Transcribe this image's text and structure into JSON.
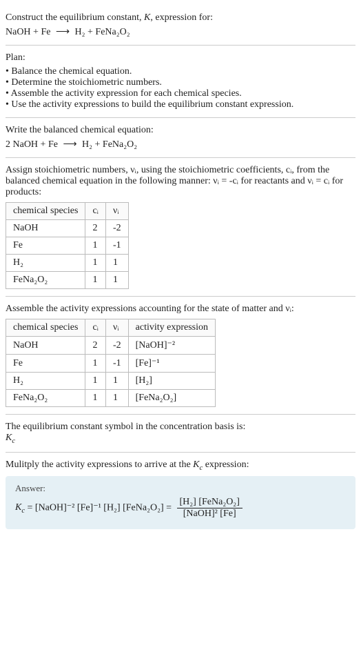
{
  "header": {
    "title_line1": "Construct the equilibrium constant, K, expression for:",
    "eq_lhs": "NaOH + Fe",
    "arrow": "⟶",
    "eq_rhs": "H₂ + FeNa₂O₂"
  },
  "plan": {
    "title": "Plan:",
    "items": [
      "Balance the chemical equation.",
      "Determine the stoichiometric numbers.",
      "Assemble the activity expression for each chemical species.",
      "Use the activity expressions to build the equilibrium constant expression."
    ]
  },
  "balanced": {
    "title": "Write the balanced chemical equation:",
    "eq_lhs": "2 NaOH + Fe",
    "arrow": "⟶",
    "eq_rhs": "H₂ + FeNa₂O₂"
  },
  "stoich": {
    "text": "Assign stoichiometric numbers, νᵢ, using the stoichiometric coefficients, cᵢ, from the balanced chemical equation in the following manner: νᵢ = -cᵢ for reactants and νᵢ = cᵢ for products:",
    "headers": {
      "species": "chemical species",
      "ci": "cᵢ",
      "vi": "νᵢ"
    },
    "rows": [
      {
        "species": "NaOH",
        "ci": "2",
        "vi": "-2"
      },
      {
        "species": "Fe",
        "ci": "1",
        "vi": "-1"
      },
      {
        "species": "H₂",
        "ci": "1",
        "vi": "1"
      },
      {
        "species": "FeNa₂O₂",
        "ci": "1",
        "vi": "1"
      }
    ]
  },
  "activity": {
    "text": "Assemble the activity expressions accounting for the state of matter and νᵢ:",
    "headers": {
      "species": "chemical species",
      "ci": "cᵢ",
      "vi": "νᵢ",
      "expr": "activity expression"
    },
    "rows": [
      {
        "species": "NaOH",
        "ci": "2",
        "vi": "-2",
        "expr": "[NaOH]⁻²"
      },
      {
        "species": "Fe",
        "ci": "1",
        "vi": "-1",
        "expr": "[Fe]⁻¹"
      },
      {
        "species": "H₂",
        "ci": "1",
        "vi": "1",
        "expr": "[H₂]"
      },
      {
        "species": "FeNa₂O₂",
        "ci": "1",
        "vi": "1",
        "expr": "[FeNa₂O₂]"
      }
    ]
  },
  "symbol": {
    "text": "The equilibrium constant symbol in the concentration basis is:",
    "kc": "K_c"
  },
  "multiply": {
    "text": "Mulitply the activity expressions to arrive at the K_c expression:"
  },
  "answer": {
    "label": "Answer:",
    "kc": "K_c",
    "flat": " = [NaOH]⁻² [Fe]⁻¹ [H₂] [FeNa₂O₂] = ",
    "num": "[H₂] [FeNa₂O₂]",
    "den": "[NaOH]² [Fe]"
  }
}
